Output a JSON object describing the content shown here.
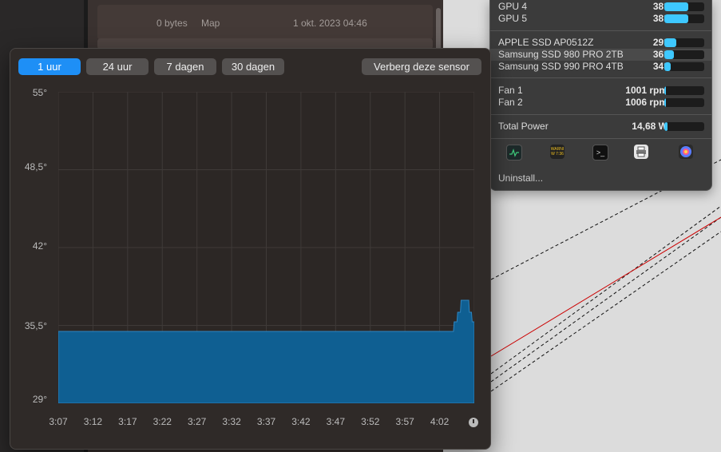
{
  "background_window": {
    "size": "0 bytes",
    "kind": "Map",
    "date": "1 okt. 2023 04:46"
  },
  "menu": {
    "gpu_items": [
      {
        "label": "GPU 4",
        "value": "38°",
        "fill": 0.6
      },
      {
        "label": "GPU 5",
        "value": "38°",
        "fill": 0.6
      }
    ],
    "ssd_items": [
      {
        "label": "APPLE SSD AP0512Z",
        "value": "29°",
        "fill": 0.3
      },
      {
        "label": "Samsung SSD 980 PRO 2TB",
        "value": "36°",
        "fill": 0.24
      },
      {
        "label": "Samsung SSD 990 PRO 4TB",
        "value": "34°",
        "fill": 0.16
      }
    ],
    "fan_items": [
      {
        "label": "Fan 1",
        "value": "1001 rpm",
        "fill": 0.03
      },
      {
        "label": "Fan 2",
        "value": "1006 rpm",
        "fill": 0.03
      }
    ],
    "power": {
      "label": "Total Power",
      "value": "14,68 W",
      "fill": 0.08
    },
    "app_icons": [
      "activity-monitor-icon",
      "console-icon",
      "terminal-icon",
      "printer-icon",
      "system-info-icon"
    ],
    "console_icon_text": "WARNI\nW 7:36",
    "uninstall_label": "Uninstall..."
  },
  "chart_window": {
    "ranges": [
      "1 uur",
      "24 uur",
      "7 dagen",
      "30 dagen"
    ],
    "active_range": "1 uur",
    "hide_sensor_label": "Verberg deze sensor"
  },
  "chart_data": {
    "type": "area",
    "y_ticks": [
      "55°",
      "48,5°",
      "42°",
      "35,5°",
      "29°"
    ],
    "ylim": [
      29,
      55
    ],
    "x_ticks": [
      "3:07",
      "3:12",
      "3:17",
      "3:22",
      "3:27",
      "3:32",
      "3:37",
      "3:42",
      "3:47",
      "3:52",
      "3:57",
      "4:02"
    ],
    "series": [
      {
        "values": [
          [
            0,
            35
          ],
          [
            57,
            35
          ],
          [
            57.1,
            35.8
          ],
          [
            57.5,
            35.8
          ],
          [
            57.6,
            36.6
          ],
          [
            58,
            36.6
          ],
          [
            58.1,
            37.6
          ],
          [
            59.2,
            37.6
          ],
          [
            59.3,
            36.6
          ],
          [
            59.6,
            36.6
          ],
          [
            59.7,
            35.8
          ],
          [
            60,
            35.8
          ]
        ]
      }
    ],
    "x_unit_minutes_start": "3:07",
    "grid": true,
    "colors": {
      "fill": "#0f5f92",
      "line": "#2e86c1",
      "grid": "#3f3a38"
    }
  }
}
